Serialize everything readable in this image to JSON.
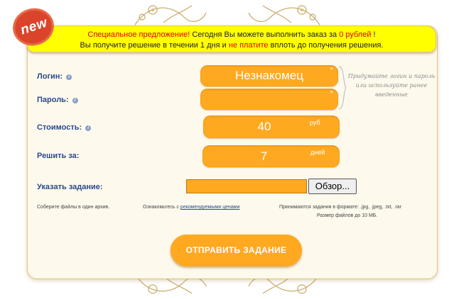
{
  "badge": {
    "text": "new"
  },
  "banner": {
    "line1_a": "Специальное предложение!",
    "line1_b": " Сегодня Вы можете выполнить заказ за ",
    "line1_c": "0 рублей",
    "line1_d": " !",
    "line2_a": "Вы получите решение в течении 1 дня и ",
    "line2_b": "не платите",
    "line2_c": " вплоть до получения решения."
  },
  "form": {
    "login_label": "Логин:",
    "login_value": "Незнакомец",
    "password_label": "Пароль:",
    "password_value": "",
    "cost_label": "Стоимость:",
    "cost_value": "40",
    "cost_unit": "руб",
    "deadline_label": "Решить за:",
    "deadline_value": "7",
    "deadline_unit": "дней",
    "task_label": "Указать задание:",
    "required_mark": "*",
    "hint": "Придумайте логин и пароль или используйте ранее введенные"
  },
  "upload": {
    "browse_label": "Обзор...",
    "note_archive": "Соберите файлы в один архив.",
    "note_prices_prefix": "Ознакомьтесь с ",
    "note_prices_link": "рекомендуемыми ценами",
    "note_formats": "Принимаются задания в формате: .jpg, .jpeg, .txt, .rar",
    "note_size": "Размер файлов до 10 МБ."
  },
  "submit_label": "ОТПРАВИТЬ ЗАДАНИЕ",
  "colors": {
    "accent": "#ffa920",
    "banner": "#ffff00",
    "label": "#2a4a8a",
    "highlight": "#e00000"
  }
}
